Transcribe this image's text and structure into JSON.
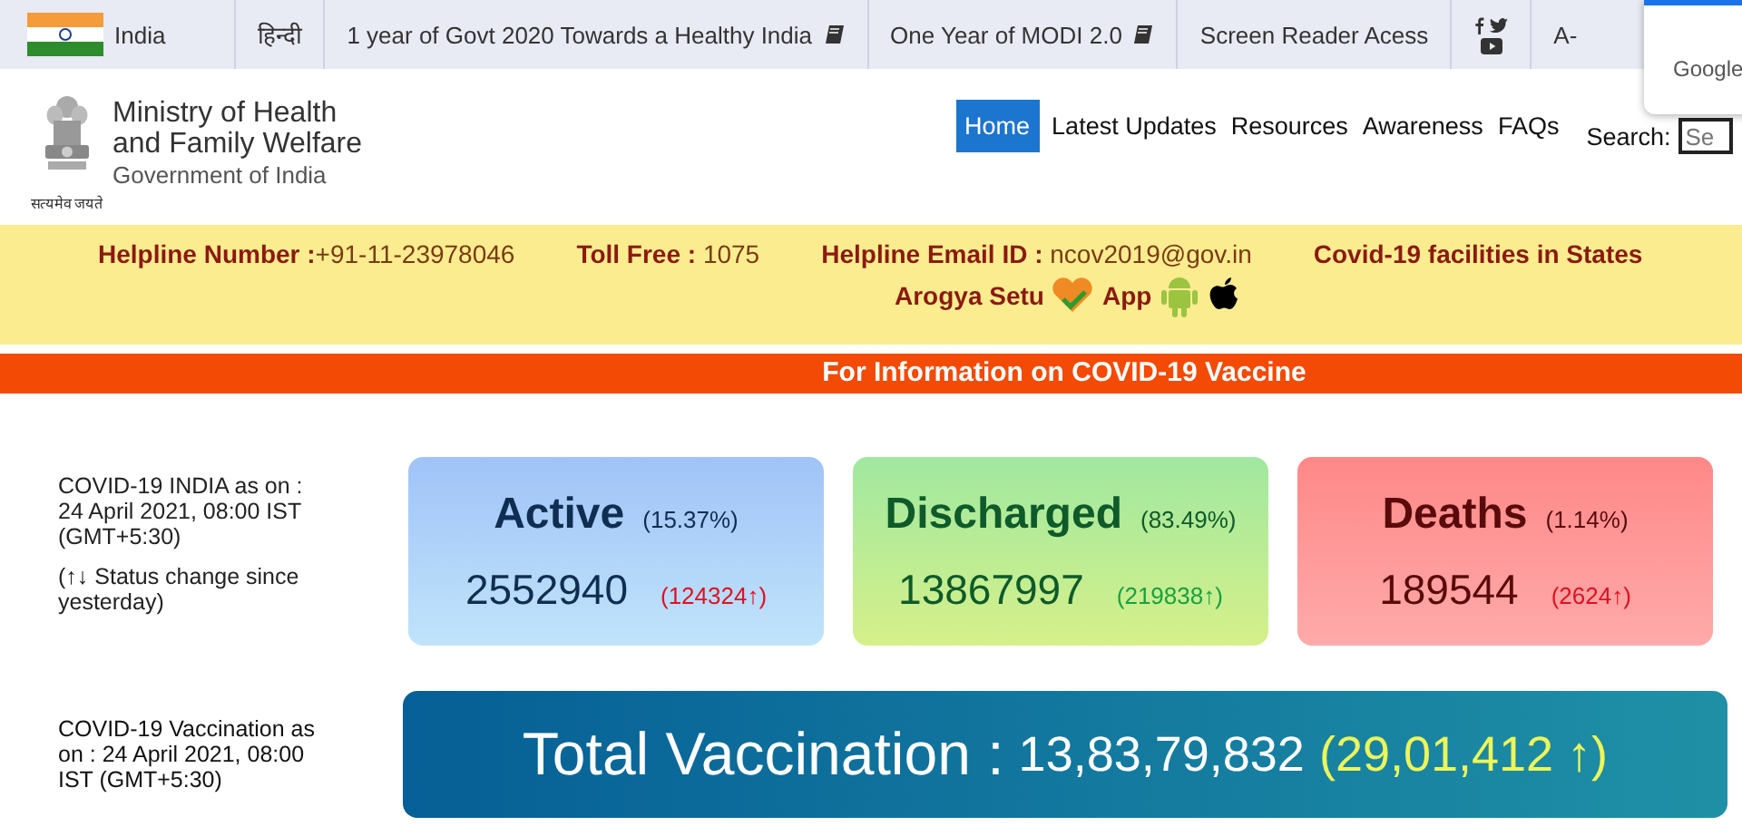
{
  "top_bar": {
    "country": "India",
    "items": [
      {
        "label": "हिन्दी",
        "icon": false
      },
      {
        "label": "1 year of Govt 2020 Towards a Healthy India",
        "icon": true
      },
      {
        "label": "One Year of MODI 2.0",
        "icon": true
      },
      {
        "label": "Screen Reader Acess",
        "icon": false
      }
    ],
    "font_size": "A-"
  },
  "popup": {
    "text": "Google"
  },
  "header": {
    "title_line_1": "Ministry of Health",
    "title_line_2": "and Family Welfare",
    "subtitle": "Government of India",
    "motto": "सत्यमेव जयते",
    "nav": [
      {
        "label": "Home",
        "selected": true
      },
      {
        "label": "Latest Updates",
        "selected": false
      },
      {
        "label": "Resources",
        "selected": false
      },
      {
        "label": "Awareness",
        "selected": false
      },
      {
        "label": "FAQs",
        "selected": false
      }
    ],
    "search": {
      "label": "Search:",
      "placeholder": "Se"
    }
  },
  "helpline": {
    "items": [
      {
        "label": "Helpline Number :",
        "value": "+91-11-23978046"
      },
      {
        "label": "Toll Free :",
        "value": " 1075"
      },
      {
        "label": "Helpline Email ID :",
        "value": " ncov2019@gov.in"
      },
      {
        "label": "Covid-19 facilities in States",
        "value": ""
      }
    ],
    "app_label": "Arogya Setu",
    "app_suffix": "App"
  },
  "vaccine_banner": "For Information on COVID-19 Vaccine",
  "stats": {
    "as_on": "COVID-19 INDIA as on : 24 April 2021, 08:00 IST (GMT+5:30)",
    "note": "(↑↓ Status change since yesterday)",
    "cards": [
      {
        "kind": "active",
        "title": "Active",
        "percent": "(15.37%)",
        "value": "2552940",
        "change": "(124324↑)"
      },
      {
        "kind": "discharged",
        "title": "Discharged",
        "percent": "(83.49%)",
        "value": "13867997",
        "change": "(219838↑)"
      },
      {
        "kind": "deaths",
        "title": "Deaths",
        "percent": "(1.14%)",
        "value": "189544",
        "change": "(2624↑)"
      }
    ]
  },
  "vaccination": {
    "as_on": "COVID-19 Vaccination as on : 24 April 2021, 08:00 IST (GMT+5:30)",
    "label": "Total Vaccination :",
    "value": "13,83,79,832",
    "change": "(29,01,412 ↑)"
  }
}
